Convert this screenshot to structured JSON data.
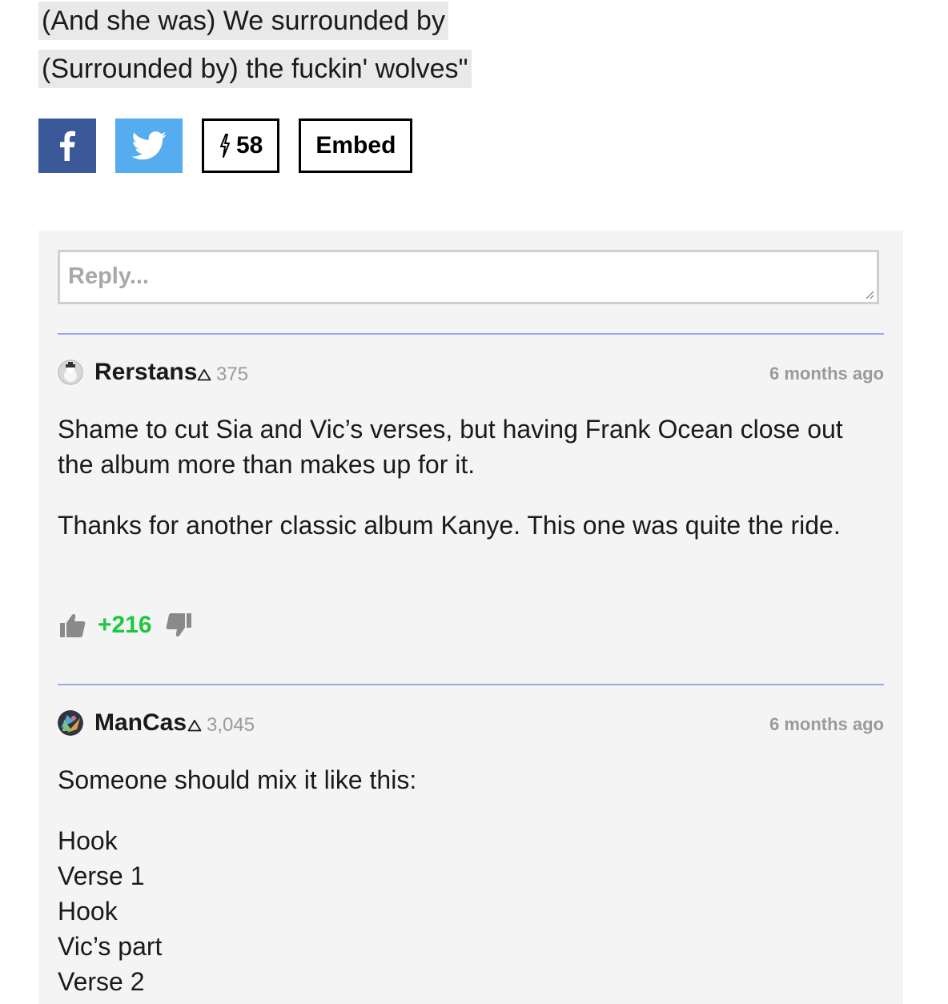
{
  "lyrics": [
    "(And she was) We surrounded by",
    "(Surrounded by) the fuckin' wolves\""
  ],
  "share": {
    "facebook_icon": "facebook-icon",
    "twitter_icon": "twitter-icon",
    "pyong_count": "58",
    "embed_label": "Embed"
  },
  "reply": {
    "placeholder": "Reply..."
  },
  "comments": [
    {
      "username": "Rerstans",
      "iq": "375",
      "timestamp": "6 months ago",
      "paragraphs": [
        "Shame to cut Sia and Vic’s verses, but having Frank Ocean close out the album more than makes up for it.",
        "Thanks for another classic album Kanye. This one was quite the ride."
      ],
      "votes": "+216"
    },
    {
      "username": "ManCas",
      "iq": "3,045",
      "timestamp": "6 months ago",
      "paragraphs": [
        "Someone should mix it like this:"
      ],
      "list": [
        "Hook",
        "Verse 1",
        "Hook",
        "Vic’s part",
        "Verse 2"
      ]
    }
  ],
  "colors": {
    "facebook": "#3b5998",
    "twitter": "#55acee",
    "upvote_green": "#1cc83e",
    "divider": "#9aa4f4"
  }
}
